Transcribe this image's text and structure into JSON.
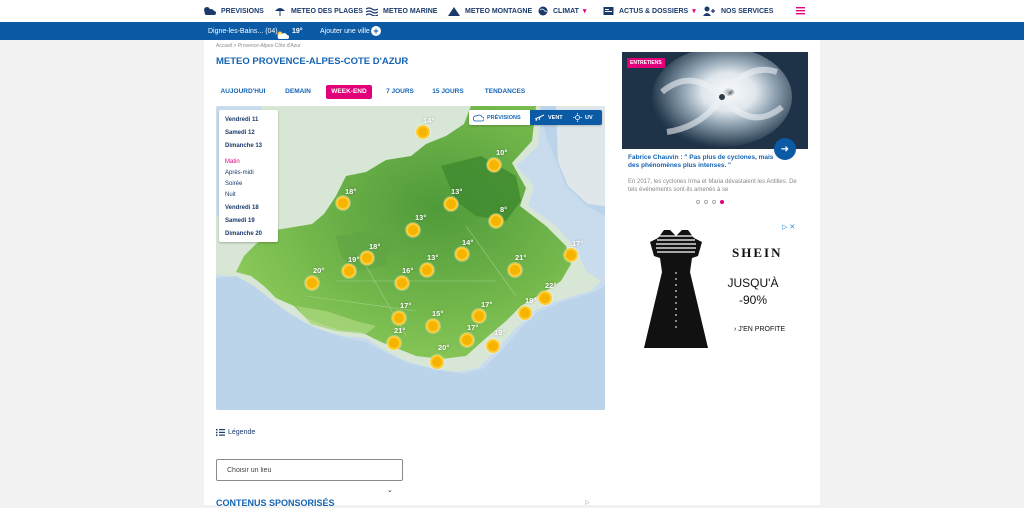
{
  "nav": {
    "items": [
      {
        "label": "PREVISIONS",
        "icon": "weather-cloud-icon"
      },
      {
        "label": "METEO DES PLAGES",
        "icon": "beach-umbrella-icon"
      },
      {
        "label": "METEO MARINE",
        "icon": "waves-icon"
      },
      {
        "label": "METEO MONTAGNE",
        "icon": "mountain-icon"
      },
      {
        "label": "CLIMAT",
        "icon": "globe-icon"
      },
      {
        "label": "ACTUS & DOSSIERS",
        "icon": "news-icon"
      },
      {
        "label": "NOS SERVICES",
        "icon": "user-add-icon"
      }
    ]
  },
  "location": {
    "city": "Digne-les-Bains... (04)",
    "temperature": "19°",
    "add_city": "Ajouter une ville"
  },
  "breadcrumb": {
    "home": "Accueil",
    "sep": ">",
    "current": "Provence-Alpes-Côte d'Azur"
  },
  "page_title": "METEO PROVENCE-ALPES-COTE D'AZUR",
  "tabs": [
    "AUJOURD'HUI",
    "DEMAIN",
    "WEEK-END",
    "7 JOURS",
    "15 JOURS",
    "TENDANCES"
  ],
  "active_tab": "WEEK-END",
  "day_panel": {
    "days_top": [
      "Vendredi 11",
      "Samedi 12",
      "Dimanche 13"
    ],
    "periods": [
      "Matin",
      "Après-midi",
      "Soirée",
      "Nuit"
    ],
    "days_bottom": [
      "Vendredi 18",
      "Samedi 19",
      "Dimanche 20"
    ],
    "active_period": "Matin"
  },
  "map_modes": {
    "forecast": "PRÉVISIONS",
    "wind": "VENT",
    "uv": "UV"
  },
  "map_temps": [
    "14°",
    "10°",
    "18°",
    "13°",
    "8°",
    "13°",
    "18°",
    "14°",
    "17°",
    "19°",
    "20°",
    "16°",
    "13°",
    "21°",
    "22°",
    "17°",
    "15°",
    "17°",
    "21°",
    "19°",
    "17°",
    "19°",
    "20°"
  ],
  "legend_label": "Légende",
  "search": {
    "placeholder": "Choisir un lieu"
  },
  "sponsored": "CONTENUS SPONSORISÉS",
  "article": {
    "badge": "ENTRETIENS",
    "title": "Fabrice Chauvin : \" Pas plus de cyclones, mais des phénomènes plus intenses. \"",
    "excerpt": "En 2017, les cyclones Irma et Maria dévastaient les Antilles. De tels événements sont-ils amenés à se"
  },
  "ad": {
    "brand": "SHEIN",
    "promo_line1": "JUSQU'À",
    "promo_line2": "-90%",
    "cta": "› J'EN PROFITE"
  }
}
